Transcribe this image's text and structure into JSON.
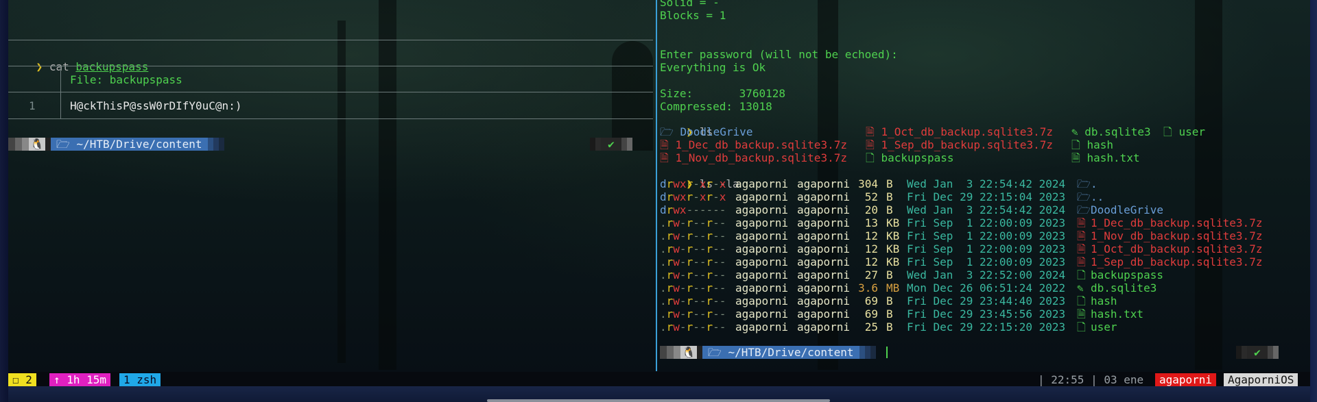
{
  "left_pane": {
    "command_prompt": "❯",
    "command": "cat",
    "command_arg": "backupspass",
    "bat_header": "File: backupspass",
    "bat_line_number": "1",
    "bat_line_text": "H@ckThisP@ssW0rDIfY0uC@n:)",
    "prompt_path": "~/HTB/Drive/content",
    "prompt_os_icon": "tux-icon",
    "prompt_ok": "✔"
  },
  "right_pane": {
    "top_output": [
      "Solid = -",
      "Blocks = 1",
      "",
      "",
      "Enter password (will not be echoed):",
      "Everything is Ok",
      "",
      "Size:       3760128",
      "Compressed: 13018"
    ],
    "cmd_ls": "ls",
    "ls_grid": [
      [
        {
          "icon": "🗁",
          "name": "DoodleGrive",
          "kind": "dir"
        },
        {
          "icon": "🗎",
          "name": "1_Oct_db_backup.sqlite3.7z",
          "kind": "archive"
        },
        {
          "icon": "✎",
          "name": "db.sqlite3",
          "kind": "file"
        },
        {
          "icon": "🗋",
          "name": "user",
          "kind": "file"
        }
      ],
      [
        {
          "icon": "🗎",
          "name": "1_Dec_db_backup.sqlite3.7z",
          "kind": "archive"
        },
        {
          "icon": "🗎",
          "name": "1_Sep_db_backup.sqlite3.7z",
          "kind": "archive"
        },
        {
          "icon": "🗋",
          "name": "hash",
          "kind": "file"
        }
      ],
      [
        {
          "icon": "🗎",
          "name": "1_Nov_db_backup.sqlite3.7z",
          "kind": "archive"
        },
        {
          "icon": "🗋",
          "name": "backupspass",
          "kind": "file"
        },
        {
          "icon": "🗎",
          "name": "hash.txt",
          "kind": "file"
        }
      ]
    ],
    "cmd_lsla": "ls -la",
    "lsla_rows": [
      {
        "perm": "drwxr-xr-x",
        "user": "agaporni",
        "group": "agaporni",
        "size": "304",
        "unit": "B",
        "date": "Wed Jan  3 22:54:42 2024",
        "icon": "🗁",
        "name": ".",
        "kind": "dir"
      },
      {
        "perm": "drwxr-xr-x",
        "user": "agaporni",
        "group": "agaporni",
        "size": "52",
        "unit": "B",
        "date": "Fri Dec 29 22:15:04 2023",
        "icon": "🗁",
        "name": "..",
        "kind": "dir"
      },
      {
        "perm": "drwx------",
        "user": "agaporni",
        "group": "agaporni",
        "size": "20",
        "unit": "B",
        "date": "Wed Jan  3 22:54:42 2024",
        "icon": "🗁",
        "name": "DoodleGrive",
        "kind": "dir"
      },
      {
        "perm": ".rw-r--r--",
        "user": "agaporni",
        "group": "agaporni",
        "size": "13",
        "unit": "KB",
        "date": "Fri Sep  1 22:00:09 2023",
        "icon": "🗎",
        "name": "1_Dec_db_backup.sqlite3.7z",
        "kind": "archive"
      },
      {
        "perm": ".rw-r--r--",
        "user": "agaporni",
        "group": "agaporni",
        "size": "12",
        "unit": "KB",
        "date": "Fri Sep  1 22:00:09 2023",
        "icon": "🗎",
        "name": "1_Nov_db_backup.sqlite3.7z",
        "kind": "archive"
      },
      {
        "perm": ".rw-r--r--",
        "user": "agaporni",
        "group": "agaporni",
        "size": "12",
        "unit": "KB",
        "date": "Fri Sep  1 22:00:09 2023",
        "icon": "🗎",
        "name": "1_Oct_db_backup.sqlite3.7z",
        "kind": "archive"
      },
      {
        "perm": ".rw-r--r--",
        "user": "agaporni",
        "group": "agaporni",
        "size": "12",
        "unit": "KB",
        "date": "Fri Sep  1 22:00:09 2023",
        "icon": "🗎",
        "name": "1_Sep_db_backup.sqlite3.7z",
        "kind": "archive"
      },
      {
        "perm": ".rw-r--r--",
        "user": "agaporni",
        "group": "agaporni",
        "size": "27",
        "unit": "B",
        "date": "Wed Jan  3 22:52:00 2024",
        "icon": "🗋",
        "name": "backupspass",
        "kind": "file"
      },
      {
        "perm": ".rw-r--r--",
        "user": "agaporni",
        "group": "agaporni",
        "size": "3.6",
        "unit": "MB",
        "date": "Mon Dec 26 06:51:24 2022",
        "icon": "✎",
        "name": "db.sqlite3",
        "kind": "file"
      },
      {
        "perm": ".rw-r--r--",
        "user": "agaporni",
        "group": "agaporni",
        "size": "69",
        "unit": "B",
        "date": "Fri Dec 29 23:44:40 2023",
        "icon": "🗋",
        "name": "hash",
        "kind": "file"
      },
      {
        "perm": ".rw-r--r--",
        "user": "agaporni",
        "group": "agaporni",
        "size": "69",
        "unit": "B",
        "date": "Fri Dec 29 23:45:56 2023",
        "icon": "🗎",
        "name": "hash.txt",
        "kind": "file"
      },
      {
        "perm": ".rw-r--r--",
        "user": "agaporni",
        "group": "agaporni",
        "size": "25",
        "unit": "B",
        "date": "Fri Dec 29 22:15:20 2023",
        "icon": "🗋",
        "name": "user",
        "kind": "file"
      }
    ],
    "prompt_path": "~/HTB/Drive/content",
    "prompt_ok": "✔"
  },
  "statusbar": {
    "windows": "☐ 2",
    "uptime": "↑ 1h 15m",
    "window_name": "1 zsh",
    "clock": "| 22:55 | 03 ene",
    "user": "agaporni",
    "host": "AgaporniOS"
  },
  "colors": {
    "green": "#4fd24f",
    "dir_blue": "#6a9ed8",
    "archive_red": "#e03c3c",
    "path_bg": "#3b6fb2",
    "status_yellow": "#f0e020",
    "status_magenta": "#e020c0",
    "status_cyan": "#20a8e8",
    "status_red": "#e01818"
  }
}
